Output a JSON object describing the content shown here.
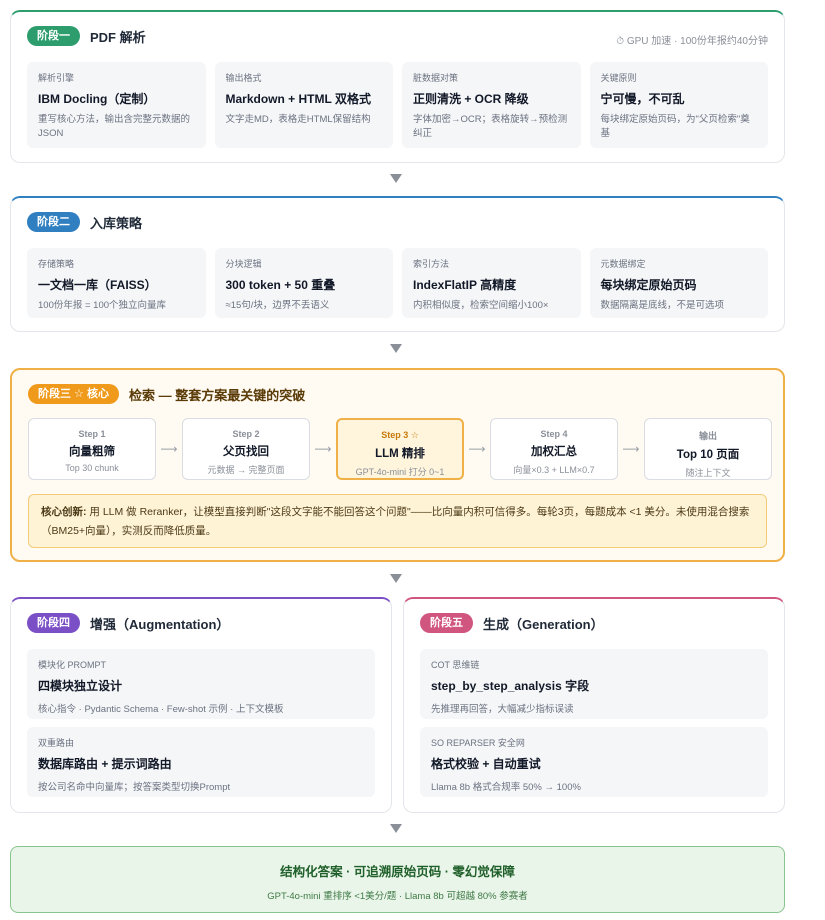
{
  "stage1": {
    "badge": "阶段一",
    "title": "PDF 解析",
    "note": "⏱ GPU 加速 · 100份年报约40分钟",
    "cells": [
      {
        "label": "解析引擎",
        "value": "IBM Docling（定制）",
        "desc": "重写核心方法，输出含完整元数据的JSON"
      },
      {
        "label": "输出格式",
        "value": "Markdown + HTML 双格式",
        "desc": "文字走MD，表格走HTML保留结构"
      },
      {
        "label": "脏数据对策",
        "value": "正则清洗 + OCR 降级",
        "desc": "字体加密→OCR；表格旋转→预检测纠正"
      },
      {
        "label": "关键原则",
        "value": "宁可慢，不可乱",
        "desc": "每块绑定原始页码，为\"父页检索\"奠基"
      }
    ]
  },
  "stage2": {
    "badge": "阶段二",
    "title": "入库策略",
    "cells": [
      {
        "label": "存储策略",
        "value": "一文档一库（FAISS）",
        "desc": "100份年报 = 100个独立向量库"
      },
      {
        "label": "分块逻辑",
        "value": "300 token + 50 重叠",
        "desc": "≈15句/块，边界不丢语义"
      },
      {
        "label": "索引方法",
        "value": "IndexFlatIP 高精度",
        "desc": "内积相似度，检索空间缩小100×"
      },
      {
        "label": "元数据绑定",
        "value": "每块绑定原始页码",
        "desc": "数据隔离是底线，不是可选项"
      }
    ]
  },
  "stage3": {
    "badge": "阶段三 ☆ 核心",
    "title": "检索 — 整套方案最关键的突破",
    "steps": [
      {
        "label": "Step 1",
        "value": "向量粗筛",
        "desc": "Top 30 chunk"
      },
      {
        "label": "Step 2",
        "value": "父页找回",
        "desc": "元数据 → 完整页面"
      },
      {
        "label": "Step 3 ☆",
        "value": "LLM 精排",
        "desc": "GPT-4o-mini 打分 0~1"
      },
      {
        "label": "Step 4",
        "value": "加权汇总",
        "desc": "向量×0.3 + LLM×0.7"
      },
      {
        "label": "输出",
        "value": "Top 10 页面",
        "desc": "随注上下文"
      }
    ],
    "arrow_glyph": "⟶",
    "innovation_key": "核心创新:",
    "innovation_text": " 用 LLM 做 Reranker，让模型直接判断\"这段文字能不能回答这个问题\"——比向量内积可信得多。每轮3页，每题成本 <1 美分。未使用混合搜索（BM25+向量），实测反而降低质量。"
  },
  "stage4": {
    "badge": "阶段四",
    "title": "增强（Augmentation）",
    "items": [
      {
        "label": "模块化 PROMPT",
        "value": "四模块独立设计",
        "desc": "核心指令 · Pydantic Schema · Few-shot 示例 · 上下文模板"
      },
      {
        "label": "双重路由",
        "value": "数据库路由 + 提示词路由",
        "desc": "按公司名命中向量库；按答案类型切换Prompt"
      }
    ]
  },
  "stage5": {
    "badge": "阶段五",
    "title": "生成（Generation）",
    "items": [
      {
        "label": "COT 思维链",
        "value": "step_by_step_analysis 字段",
        "desc": "先推理再回答，大幅减少指标误读"
      },
      {
        "label": "SO REPARSER 安全网",
        "value": "格式校验 + 自动重试",
        "desc": "Llama 8b 格式合规率 50% → 100%"
      }
    ]
  },
  "final": {
    "title": "结构化答案 · 可追溯原始页码 · 零幻觉保障",
    "subtitle": "GPT-4o-mini 重排序 <1美分/题 · Llama 8b 可超越 80% 参赛者"
  }
}
